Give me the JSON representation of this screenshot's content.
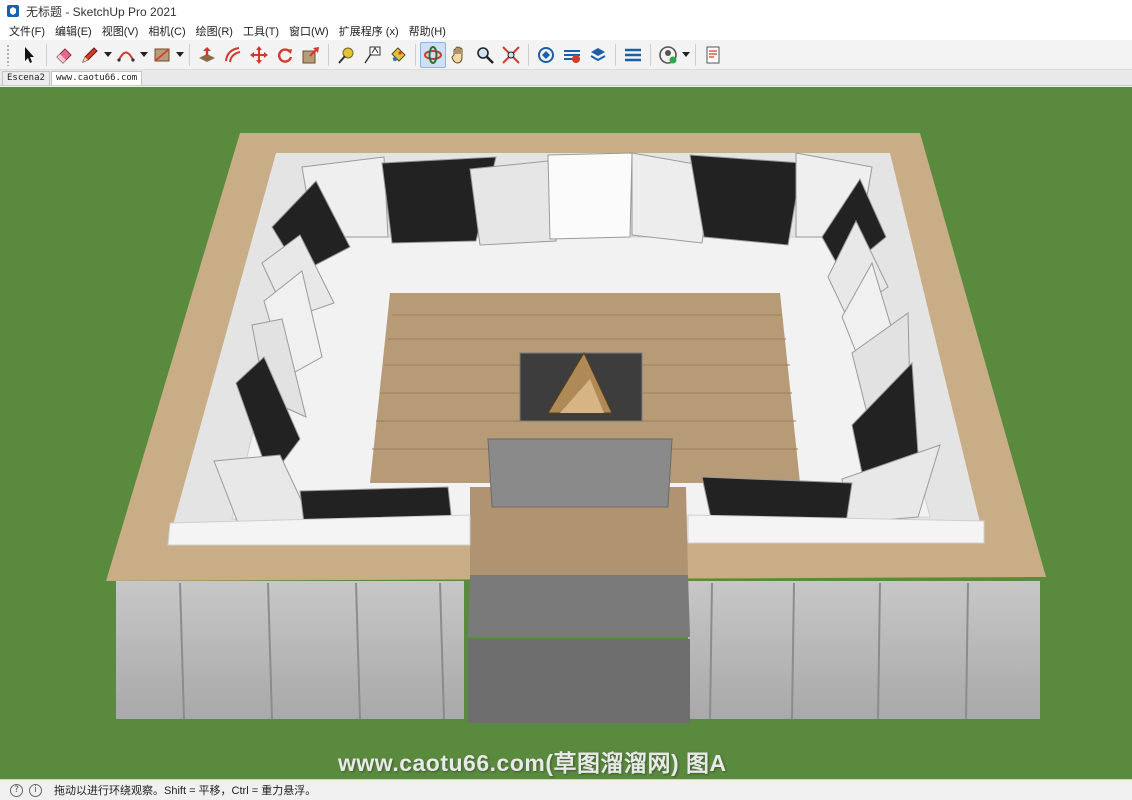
{
  "window": {
    "title": "无标题 - SketchUp Pro 2021"
  },
  "menu": [
    "文件(F)",
    "编辑(E)",
    "视图(V)",
    "相机(C)",
    "绘图(R)",
    "工具(T)",
    "窗口(W)",
    "扩展程序 (x)",
    "帮助(H)"
  ],
  "toolbar": {
    "tools": [
      "select-icon",
      "eraser-icon",
      "pencil-icon",
      "arc-icon",
      "rectangle-icon",
      "push-pull-icon",
      "offset-icon",
      "move-icon",
      "rotate-icon",
      "scale-icon",
      "tape-measure-icon",
      "text-icon",
      "paint-bucket-icon",
      "orbit-icon",
      "pan-icon",
      "zoom-icon",
      "zoom-extents-icon",
      "warehouse-icon",
      "extension-warehouse-icon",
      "layout-icon",
      "extension-manager-icon",
      "account-icon",
      "report-icon"
    ],
    "active_tool": "orbit-icon"
  },
  "scenes": {
    "tabs": [
      "Escena2",
      "www.caotu66.com"
    ],
    "active_index": 1
  },
  "viewport": {
    "watermark": "www.caotu66.com(草图溜溜网) 图A",
    "background_color": "#5a8a3e"
  },
  "status": {
    "text": "拖动以进行环绕观察。Shift = 平移，Ctrl = 重力悬浮。"
  }
}
